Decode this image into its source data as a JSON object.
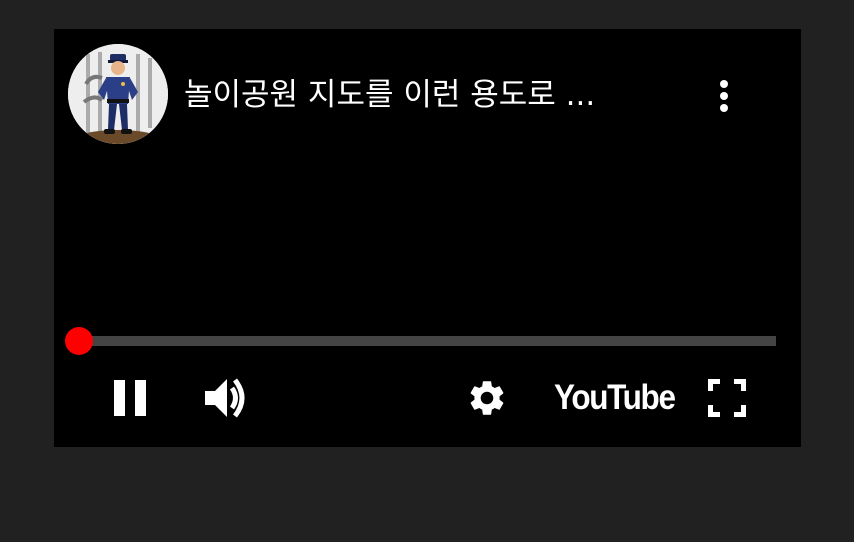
{
  "video": {
    "title": "놀이공원 지도를 이런 용도로 ...",
    "channel_avatar_icon": "police-officer-avatar"
  },
  "header": {
    "more_icon": "more-vert-icon"
  },
  "progress": {
    "played_fraction": 0.0,
    "played_color": "#ff0000",
    "track_color": "#444444"
  },
  "controls": {
    "pause_icon": "pause-icon",
    "volume_icon": "volume-icon",
    "settings_icon": "gear-icon",
    "logo_text": "YouTube",
    "fullscreen_icon": "fullscreen-icon"
  },
  "colors": {
    "page_background": "#212121",
    "player_background": "#000000",
    "text": "#ffffff",
    "accent": "#ff0000"
  }
}
